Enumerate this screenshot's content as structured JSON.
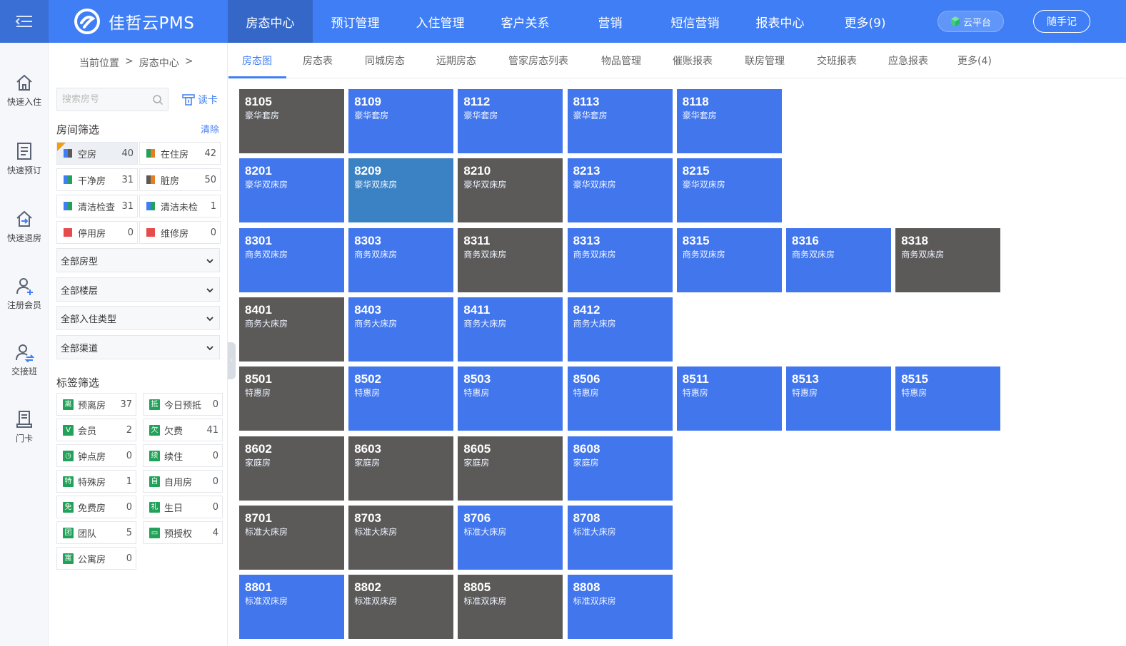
{
  "app": {
    "brand": "佳哲云PMS",
    "cloud_label": "云平台",
    "notes_label": "随手记",
    "colors": {
      "primary": "#3f7ef5",
      "topbar_active": "#3567c9",
      "vacant": "#4176ed",
      "occupied": "#5b5a59",
      "selected": "#3b82c4"
    }
  },
  "topnav": [
    {
      "label": "房态中心",
      "active": true
    },
    {
      "label": "预订管理"
    },
    {
      "label": "入住管理"
    },
    {
      "label": "客户关系"
    },
    {
      "label": "营销"
    },
    {
      "label": "短信营销"
    },
    {
      "label": "报表中心"
    },
    {
      "label": "更多(9)"
    }
  ],
  "rail": [
    {
      "label": "快速入住",
      "icon": "home-icon"
    },
    {
      "label": "快速预订",
      "icon": "list-icon"
    },
    {
      "label": "快速退房",
      "icon": "checkout-icon"
    },
    {
      "label": "注册会员",
      "icon": "add-user-icon"
    },
    {
      "label": "交接班",
      "icon": "handover-icon"
    },
    {
      "label": "门卡",
      "icon": "card-icon"
    }
  ],
  "breadcrumb": {
    "prefix": "当前位置",
    "sep": ">",
    "current": "房态中心",
    "sep2": ">"
  },
  "search": {
    "placeholder": "搜索房号",
    "value": ""
  },
  "read_card": "读卡",
  "room_filter": {
    "title": "房间筛选",
    "clear": "清除",
    "items": [
      {
        "label": "空房",
        "count": "40",
        "colors": [
          "#3f7ef5",
          "#5b5a59"
        ],
        "selected": true
      },
      {
        "label": "在住房",
        "count": "42",
        "colors": [
          "#23a05a",
          "#e67e22"
        ]
      },
      {
        "label": "干净房",
        "count": "31",
        "colors": [
          "#3f7ef5",
          "#23a05a"
        ]
      },
      {
        "label": "脏房",
        "count": "50",
        "colors": [
          "#5b5a59",
          "#e67e22"
        ]
      },
      {
        "label": "清洁检查",
        "count": "31",
        "colors": [
          "#3f7ef5",
          "#23a05a"
        ]
      },
      {
        "label": "清洁未检",
        "count": "1",
        "colors": [
          "#3f7ef5",
          "#23a05a"
        ]
      },
      {
        "label": "停用房",
        "count": "0",
        "colors": [
          "#e74c4c",
          "#e74c4c"
        ]
      },
      {
        "label": "维修房",
        "count": "0",
        "colors": [
          "#e74c4c",
          "#e74c4c"
        ]
      }
    ]
  },
  "selects": [
    {
      "value": "全部房型"
    },
    {
      "value": "全部楼层"
    },
    {
      "value": "全部入住类型"
    },
    {
      "value": "全部渠道"
    }
  ],
  "tag_filter": {
    "title": "标签筛选",
    "items": [
      {
        "label": "预离房",
        "count": "37",
        "glyph": "离"
      },
      {
        "label": "今日预抵",
        "count": "0",
        "glyph": "抵"
      },
      {
        "label": "会员",
        "count": "2",
        "glyph": "V"
      },
      {
        "label": "欠费",
        "count": "41",
        "glyph": "欠"
      },
      {
        "label": "钟点房",
        "count": "0",
        "glyph": "◷"
      },
      {
        "label": "续住",
        "count": "0",
        "glyph": "续"
      },
      {
        "label": "特殊房",
        "count": "1",
        "glyph": "特"
      },
      {
        "label": "自用房",
        "count": "0",
        "glyph": "自"
      },
      {
        "label": "免费房",
        "count": "0",
        "glyph": "免"
      },
      {
        "label": "生日",
        "count": "0",
        "glyph": "礼"
      },
      {
        "label": "团队",
        "count": "5",
        "glyph": "团"
      },
      {
        "label": "预授权",
        "count": "4",
        "glyph": "▭"
      },
      {
        "label": "公寓房",
        "count": "0",
        "glyph": "寓"
      }
    ]
  },
  "subnav": [
    {
      "label": "房态图",
      "active": true
    },
    {
      "label": "房态表"
    },
    {
      "label": "同城房态"
    },
    {
      "label": "远期房态"
    },
    {
      "label": "管家房态列表"
    },
    {
      "label": "物品管理"
    },
    {
      "label": "催账报表"
    },
    {
      "label": "联房管理"
    },
    {
      "label": "交班报表"
    },
    {
      "label": "应急报表"
    },
    {
      "label": "更多(4)"
    }
  ],
  "rooms": [
    [
      {
        "no": "8105",
        "type": "豪华套房",
        "status": "occupied"
      },
      {
        "no": "8109",
        "type": "豪华套房",
        "status": "vacant"
      },
      {
        "no": "8112",
        "type": "豪华套房",
        "status": "vacant"
      },
      {
        "no": "8113",
        "type": "豪华套房",
        "status": "vacant"
      },
      {
        "no": "8118",
        "type": "豪华套房",
        "status": "vacant"
      }
    ],
    [
      {
        "no": "8201",
        "type": "豪华双床房",
        "status": "vacant"
      },
      {
        "no": "8209",
        "type": "豪华双床房",
        "status": "selected"
      },
      {
        "no": "8210",
        "type": "豪华双床房",
        "status": "occupied"
      },
      {
        "no": "8213",
        "type": "豪华双床房",
        "status": "vacant"
      },
      {
        "no": "8215",
        "type": "豪华双床房",
        "status": "vacant"
      }
    ],
    [
      {
        "no": "8301",
        "type": "商务双床房",
        "status": "vacant"
      },
      {
        "no": "8303",
        "type": "商务双床房",
        "status": "vacant"
      },
      {
        "no": "8311",
        "type": "商务双床房",
        "status": "occupied"
      },
      {
        "no": "8313",
        "type": "商务双床房",
        "status": "vacant"
      },
      {
        "no": "8315",
        "type": "商务双床房",
        "status": "vacant"
      },
      {
        "no": "8316",
        "type": "商务双床房",
        "status": "vacant"
      },
      {
        "no": "8318",
        "type": "商务双床房",
        "status": "occupied"
      }
    ],
    [
      {
        "no": "8401",
        "type": "商务大床房",
        "status": "occupied"
      },
      {
        "no": "8403",
        "type": "商务大床房",
        "status": "vacant"
      },
      {
        "no": "8411",
        "type": "商务大床房",
        "status": "vacant"
      },
      {
        "no": "8412",
        "type": "商务大床房",
        "status": "vacant"
      }
    ],
    [
      {
        "no": "8501",
        "type": "特惠房",
        "status": "occupied"
      },
      {
        "no": "8502",
        "type": "特惠房",
        "status": "vacant"
      },
      {
        "no": "8503",
        "type": "特惠房",
        "status": "vacant"
      },
      {
        "no": "8506",
        "type": "特惠房",
        "status": "vacant"
      },
      {
        "no": "8511",
        "type": "特惠房",
        "status": "vacant"
      },
      {
        "no": "8513",
        "type": "特惠房",
        "status": "vacant"
      },
      {
        "no": "8515",
        "type": "特惠房",
        "status": "vacant"
      }
    ],
    [
      {
        "no": "8602",
        "type": "家庭房",
        "status": "occupied"
      },
      {
        "no": "8603",
        "type": "家庭房",
        "status": "occupied"
      },
      {
        "no": "8605",
        "type": "家庭房",
        "status": "occupied"
      },
      {
        "no": "8608",
        "type": "家庭房",
        "status": "vacant"
      }
    ],
    [
      {
        "no": "8701",
        "type": "标准大床房",
        "status": "occupied"
      },
      {
        "no": "8703",
        "type": "标准大床房",
        "status": "occupied"
      },
      {
        "no": "8706",
        "type": "标准大床房",
        "status": "vacant"
      },
      {
        "no": "8708",
        "type": "标准大床房",
        "status": "vacant"
      }
    ],
    [
      {
        "no": "8801",
        "type": "标准双床房",
        "status": "vacant"
      },
      {
        "no": "8802",
        "type": "标准双床房",
        "status": "occupied"
      },
      {
        "no": "8805",
        "type": "标准双床房",
        "status": "occupied"
      },
      {
        "no": "8808",
        "type": "标准双床房",
        "status": "vacant"
      }
    ]
  ]
}
